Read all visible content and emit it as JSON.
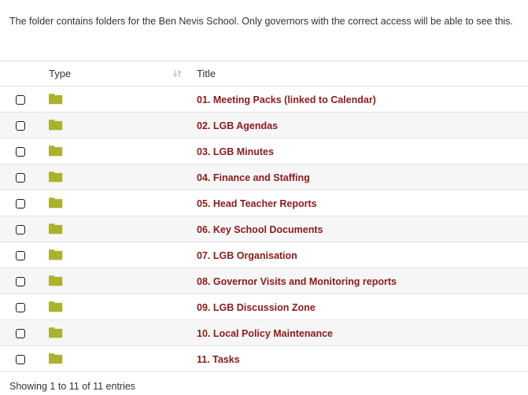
{
  "intro": {
    "text": "The folder contains folders for the Ben Nevis School. Only governors with the correct access will be able to see this."
  },
  "table": {
    "columns": {
      "checkbox": "",
      "type": "Type",
      "title": "Title"
    },
    "sort_icon": "sort-both-icon",
    "rows": [
      {
        "type_icon": "folder-icon",
        "title": "01. Meeting Packs (linked to Calendar)"
      },
      {
        "type_icon": "folder-icon",
        "title": "02. LGB Agendas"
      },
      {
        "type_icon": "folder-icon",
        "title": "03. LGB Minutes"
      },
      {
        "type_icon": "folder-icon",
        "title": "04. Finance and Staffing"
      },
      {
        "type_icon": "folder-icon",
        "title": "05. Head Teacher Reports"
      },
      {
        "type_icon": "folder-icon",
        "title": "06. Key School Documents"
      },
      {
        "type_icon": "folder-icon",
        "title": "07. LGB Organisation"
      },
      {
        "type_icon": "folder-icon",
        "title": "08. Governor Visits and Monitoring reports"
      },
      {
        "type_icon": "folder-icon",
        "title": "09. LGB Discussion Zone"
      },
      {
        "type_icon": "folder-icon",
        "title": "10. Local Policy Maintenance"
      },
      {
        "type_icon": "folder-icon",
        "title": "11. Tasks"
      }
    ]
  },
  "footer": {
    "info": "Showing 1 to 11 of 11 entries"
  },
  "colors": {
    "folder": "#AAB22E",
    "title_link": "#8B1A1A",
    "row_stripe": "#f6f6f6",
    "border": "#e3e3e3",
    "sort_icon": "#c4c4c4"
  }
}
